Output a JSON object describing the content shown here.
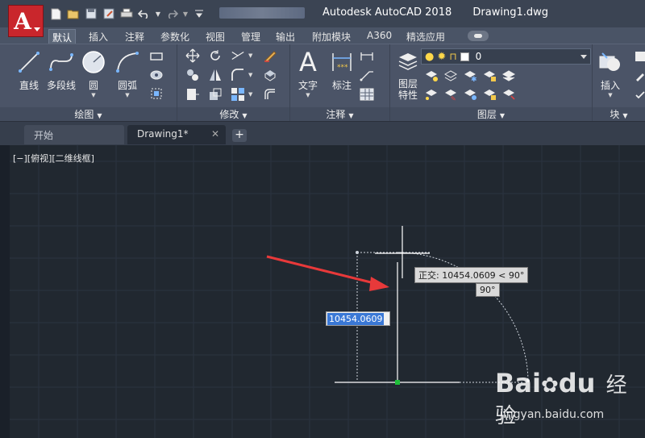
{
  "window": {
    "app_title": "Autodesk AutoCAD 2018",
    "doc_title": "Drawing1.dwg",
    "app_button_letter": "A"
  },
  "quick_access": [
    "new-icon",
    "open-icon",
    "save-icon",
    "save-as-icon",
    "plot-icon",
    "undo-icon",
    "redo-icon",
    "customize-icon"
  ],
  "ribbon_tabs": [
    {
      "label": "默认",
      "active": true
    },
    {
      "label": "插入"
    },
    {
      "label": "注释"
    },
    {
      "label": "参数化"
    },
    {
      "label": "视图"
    },
    {
      "label": "管理"
    },
    {
      "label": "输出"
    },
    {
      "label": "附加模块"
    },
    {
      "label": "A360"
    },
    {
      "label": "精选应用"
    }
  ],
  "panels": {
    "draw": {
      "title": "绘图",
      "tools": {
        "line": "直线",
        "polyline": "多段线",
        "circle": "圆",
        "arc": "圆弧"
      }
    },
    "modify": {
      "title": "修改"
    },
    "annotation": {
      "title": "注释",
      "tools": {
        "text": "文字",
        "dimension": "标注"
      }
    },
    "layers": {
      "title": "图层",
      "current_layer": "0",
      "tools": {
        "layer_properties": "图层\n特性"
      }
    },
    "block": {
      "title": "块",
      "tools": {
        "insert": "插入"
      }
    }
  },
  "file_tabs": [
    {
      "label": "开始"
    },
    {
      "label": "Drawing1*",
      "active": true
    }
  ],
  "viewport": {
    "label": "[−][俯视][二维线框]"
  },
  "tooltips": {
    "ortho": "正交: 10454.0609 < 90°",
    "angle": "90°",
    "dynamic_input": "10454.0609"
  },
  "watermark": {
    "brand": "Bai",
    "brand2": "du",
    "cn": "经验",
    "url": "jingyan.baidu.com"
  },
  "colors": {
    "titlebar": "#3b4453",
    "ribbon": "#4b5467",
    "canvas": "#212830",
    "app_button": "#c9262c",
    "arrow": "#e8393a",
    "selection": "#3a78d6"
  }
}
